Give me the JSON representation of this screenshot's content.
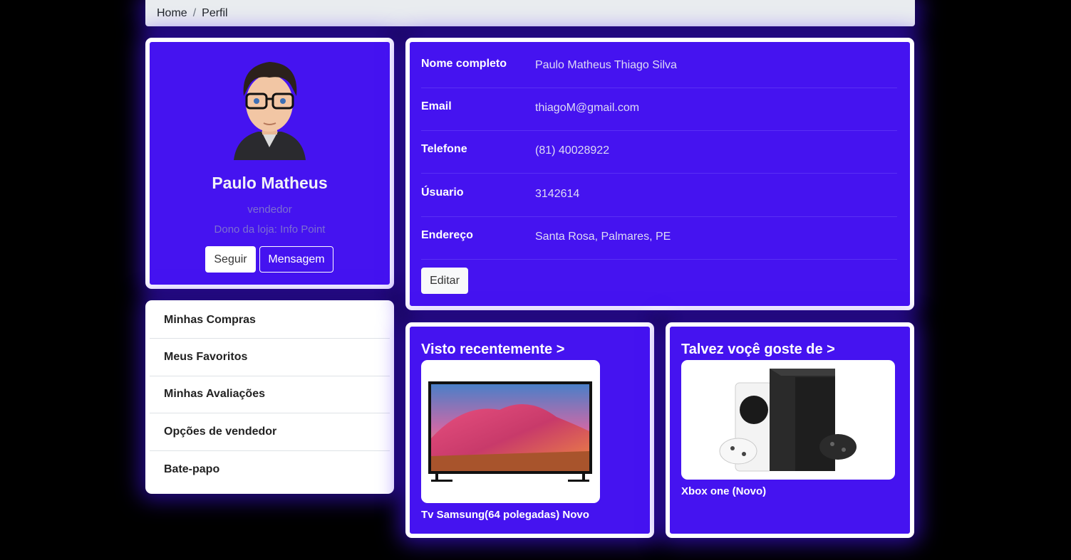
{
  "breadcrumb": {
    "home": "Home",
    "separator": "/",
    "current": "Perfil"
  },
  "profile": {
    "name": "Paulo Matheus",
    "role": "vendedor",
    "store": "Dono da loja: Info Point",
    "follow_label": "Seguir",
    "message_label": "Mensagem"
  },
  "menu": {
    "items": [
      {
        "label": "Minhas Compras"
      },
      {
        "label": "Meus Favoritos"
      },
      {
        "label": "Minhas Avaliações"
      },
      {
        "label": "Opções de vendedor"
      },
      {
        "label": "Bate-papo"
      }
    ]
  },
  "details": {
    "rows": [
      {
        "label": "Nome completo",
        "value": "Paulo Matheus Thiago Silva"
      },
      {
        "label": "Email",
        "value": "thiagoM@gmail.com"
      },
      {
        "label": "Telefone",
        "value": "(81) 40028922"
      },
      {
        "label": "Úsuario",
        "value": "3142614"
      },
      {
        "label": "Endereço",
        "value": "Santa Rosa, Palmares, PE"
      }
    ],
    "edit_label": "Editar"
  },
  "recent": {
    "title": "Visto recentemente >",
    "product": "Tv Samsung(64 polegadas) Novo"
  },
  "suggest": {
    "title": "Talvez voçê goste de >",
    "product": "Xbox one (Novo)"
  },
  "colors": {
    "accent": "#4513f0",
    "glow": "#4614ff",
    "card_border": "#ffffff"
  },
  "icons": {
    "avatar": "cartoon-avatar",
    "tv": "tv-image",
    "xbox": "xbox-image"
  }
}
